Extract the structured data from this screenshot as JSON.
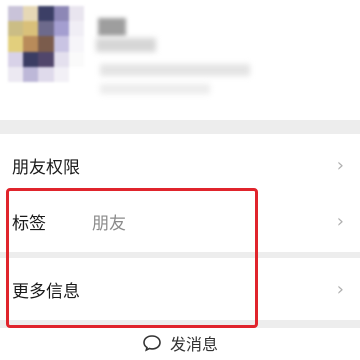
{
  "profile": {
    "avatar_colors": [
      "#c9c3d9",
      "#e6d8b6",
      "#3c3f66",
      "#8d87b6",
      "#e9e5ef",
      "#cbbd85",
      "#d9c07a",
      "#6d6a8c",
      "#a49ed0",
      "#f0eef5",
      "#e2cf7d",
      "#b98b5a",
      "#7b5c4c",
      "#c9c4e3",
      "#f6f5f9",
      "#d8d2e8",
      "#3b3d63",
      "#51466b",
      "#e4e0ee",
      "#fafafa",
      "#ece9f2",
      "#bdb8d8",
      "#dfdaeb",
      "#f2f0f6",
      "#ffffff"
    ]
  },
  "rows": [
    {
      "label": "朋友权限",
      "value": "",
      "chevron": "›"
    },
    {
      "label": "标签",
      "value": "朋友",
      "chevron": "›"
    },
    {
      "label": "更多信息",
      "value": "",
      "chevron": "›"
    }
  ],
  "send": {
    "label": "发消息",
    "icon": "chat-bubble-icon"
  },
  "accent": {
    "highlight": "#e0242c",
    "divider": "#ededed"
  }
}
